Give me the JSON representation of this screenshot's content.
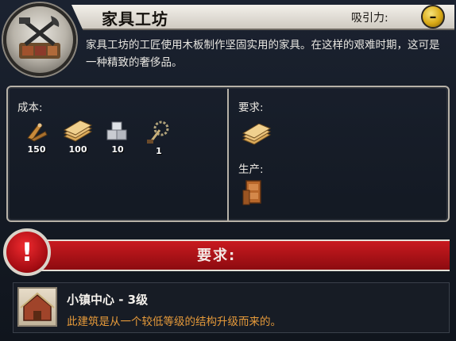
{
  "building": {
    "title": "家具工坊",
    "description": "家具工坊的工匠使用木板制作坚固实用的家具。在这样的艰难时期，这可是一种精致的奢侈品。",
    "appeal_label": "吸引力:",
    "appeal_value": "–"
  },
  "cost": {
    "label": "成本:",
    "items": [
      {
        "icon": "lumber-icon",
        "qty": "150"
      },
      {
        "icon": "planks-icon",
        "qty": "100"
      },
      {
        "icon": "stone-blocks-icon",
        "qty": "10"
      },
      {
        "icon": "saw-tool-icon",
        "qty": "1"
      }
    ]
  },
  "requires": {
    "label": "要求:",
    "icon": "planks-icon"
  },
  "produces": {
    "label": "生产:",
    "icon": "furniture-icon"
  },
  "banner": {
    "label": "要求:",
    "alert": "!"
  },
  "requirement": {
    "name": "小镇中心 - 3级",
    "note": "此建筑是从一个较低等级的结构升级而来的。"
  },
  "colors": {
    "banner_red": "#b5151a",
    "note_orange": "#e69a3a",
    "appeal_gold": "#d9a915"
  }
}
